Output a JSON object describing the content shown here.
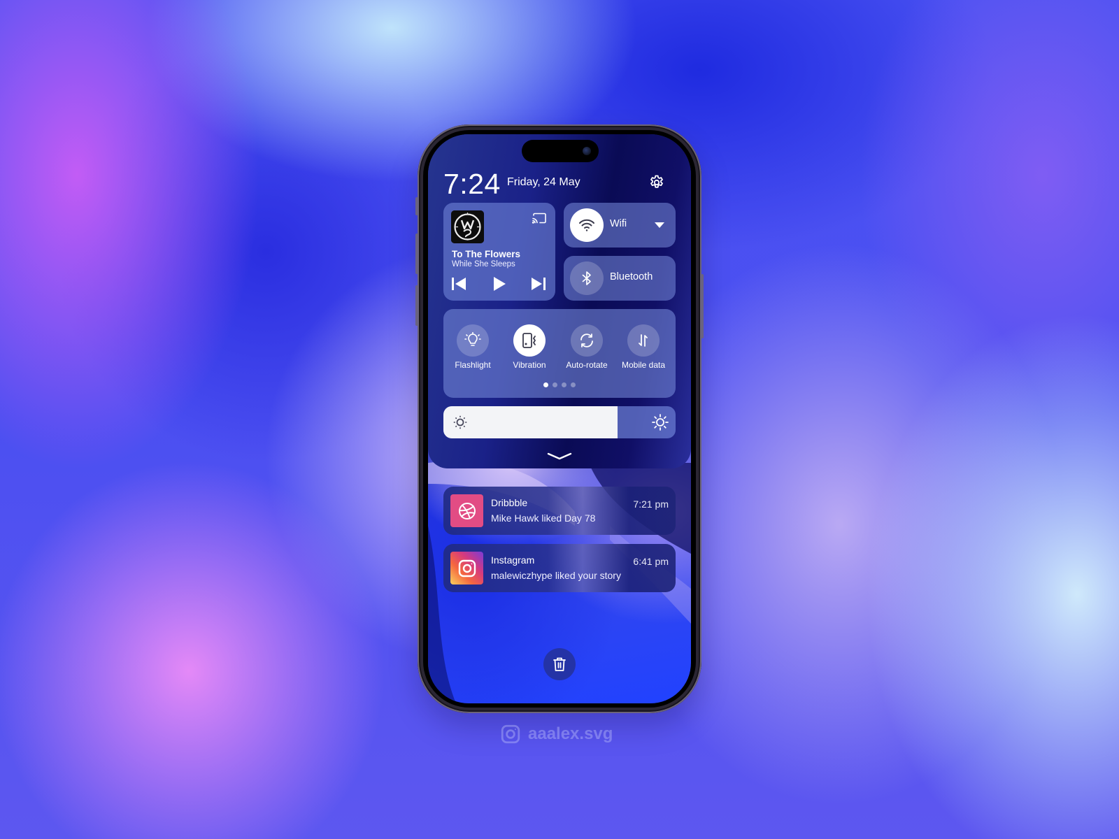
{
  "status": {
    "time": "7:24",
    "date": "Friday, 24 May"
  },
  "media": {
    "title": "To The Flowers",
    "artist": "While She Sleeps",
    "controls": [
      "previous",
      "play",
      "next"
    ]
  },
  "connectivity": {
    "wifi": {
      "label": "Wifi",
      "state": "on"
    },
    "bluetooth": {
      "label": "Bluetooth",
      "state": "off"
    }
  },
  "quick_toggles": {
    "items": [
      {
        "label": "Flashlight",
        "state": "off",
        "icon": "flashlight-icon"
      },
      {
        "label": "Vibration",
        "state": "on",
        "icon": "vibration-icon"
      },
      {
        "label": "Auto-rotate",
        "state": "off",
        "icon": "auto-rotate-icon"
      },
      {
        "label": "Mobile data",
        "state": "off",
        "icon": "mobile-data-icon"
      }
    ],
    "page": 1,
    "page_count": 4
  },
  "brightness": {
    "level_percent": 75
  },
  "notifications": [
    {
      "app": "Dribbble",
      "message": "Mike Hawk liked Day 78",
      "time": "7:21 pm",
      "color": "#e24c84"
    },
    {
      "app": "Instagram",
      "message": "malewiczhype liked your story",
      "time": "6:41 pm"
    }
  ],
  "watermark": {
    "handle": "aaalex.svg"
  }
}
